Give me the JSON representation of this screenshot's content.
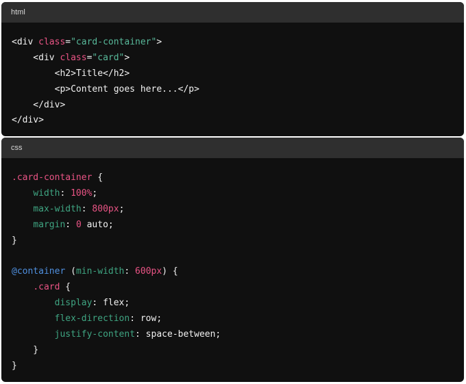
{
  "html_block": {
    "language_label": "html",
    "lines": [
      [
        {
          "t": "<div ",
          "c": "plain"
        },
        {
          "t": "class",
          "c": "attr"
        },
        {
          "t": "=",
          "c": "plain"
        },
        {
          "t": "\"card-container\"",
          "c": "string"
        },
        {
          "t": ">",
          "c": "plain"
        }
      ],
      [
        {
          "t": "    <div ",
          "c": "plain"
        },
        {
          "t": "class",
          "c": "attr"
        },
        {
          "t": "=",
          "c": "plain"
        },
        {
          "t": "\"card\"",
          "c": "string"
        },
        {
          "t": ">",
          "c": "plain"
        }
      ],
      [
        {
          "t": "        <h2>Title</h2>",
          "c": "plain"
        }
      ],
      [
        {
          "t": "        <p>Content goes here...</p>",
          "c": "plain"
        }
      ],
      [
        {
          "t": "    </div>",
          "c": "plain"
        }
      ],
      [
        {
          "t": "</div>",
          "c": "plain"
        }
      ]
    ]
  },
  "css_block": {
    "language_label": "css",
    "lines": [
      [
        {
          "t": ".card-container",
          "c": "selector"
        },
        {
          "t": " {",
          "c": "plain"
        }
      ],
      [
        {
          "t": "    ",
          "c": "plain"
        },
        {
          "t": "width",
          "c": "prop"
        },
        {
          "t": ": ",
          "c": "plain"
        },
        {
          "t": "100%",
          "c": "num"
        },
        {
          "t": ";",
          "c": "plain"
        }
      ],
      [
        {
          "t": "    ",
          "c": "plain"
        },
        {
          "t": "max-width",
          "c": "prop"
        },
        {
          "t": ": ",
          "c": "plain"
        },
        {
          "t": "800px",
          "c": "num"
        },
        {
          "t": ";",
          "c": "plain"
        }
      ],
      [
        {
          "t": "    ",
          "c": "plain"
        },
        {
          "t": "margin",
          "c": "prop"
        },
        {
          "t": ": ",
          "c": "plain"
        },
        {
          "t": "0",
          "c": "num"
        },
        {
          "t": " auto;",
          "c": "plain"
        }
      ],
      [
        {
          "t": "}",
          "c": "plain"
        }
      ],
      [],
      [
        {
          "t": "@container",
          "c": "at"
        },
        {
          "t": " (",
          "c": "plain"
        },
        {
          "t": "min-width",
          "c": "prop"
        },
        {
          "t": ": ",
          "c": "plain"
        },
        {
          "t": "600px",
          "c": "num"
        },
        {
          "t": ") {",
          "c": "plain"
        }
      ],
      [
        {
          "t": "    ",
          "c": "plain"
        },
        {
          "t": ".card",
          "c": "selector"
        },
        {
          "t": " {",
          "c": "plain"
        }
      ],
      [
        {
          "t": "        ",
          "c": "plain"
        },
        {
          "t": "display",
          "c": "prop"
        },
        {
          "t": ": flex;",
          "c": "plain"
        }
      ],
      [
        {
          "t": "        ",
          "c": "plain"
        },
        {
          "t": "flex-direction",
          "c": "prop"
        },
        {
          "t": ": row;",
          "c": "plain"
        }
      ],
      [
        {
          "t": "        ",
          "c": "plain"
        },
        {
          "t": "justify-content",
          "c": "prop"
        },
        {
          "t": ": space-between;",
          "c": "plain"
        }
      ],
      [
        {
          "t": "    }",
          "c": "plain"
        }
      ],
      [
        {
          "t": "}",
          "c": "plain"
        }
      ]
    ]
  },
  "colors": {
    "background": "#101010",
    "header": "#2f2f2f",
    "text": "#f2f2f2",
    "attribute": "#ea5485",
    "string": "#58b99a",
    "property": "#3fa582",
    "number": "#ea5485",
    "at_rule": "#4f90e0"
  }
}
